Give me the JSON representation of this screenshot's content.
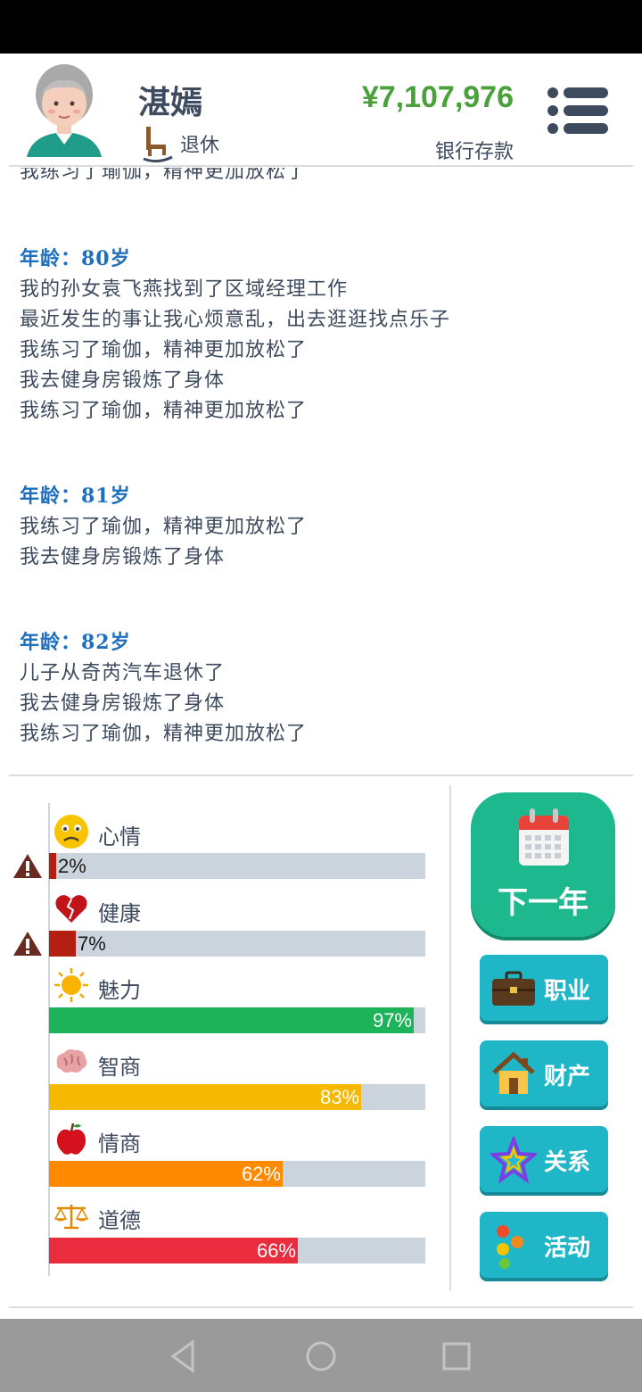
{
  "header": {
    "name": "湛嫣",
    "status": "退休",
    "money": "¥7,107,976",
    "money_label": "银行存款"
  },
  "log": {
    "cut_line": "我练习了瑜伽，精神更加放松了",
    "entries": [
      {
        "age": "年龄：80岁",
        "lines": [
          "我的孙女袁飞燕找到了区域经理工作",
          "最近发生的事让我心烦意乱，出去逛逛找点乐子",
          "我练习了瑜伽，精神更加放松了",
          "我去健身房锻炼了身体",
          "我练习了瑜伽，精神更加放松了"
        ]
      },
      {
        "age": "年龄：81岁",
        "lines": [
          "我练习了瑜伽，精神更加放松了",
          "我去健身房锻炼了身体"
        ]
      },
      {
        "age": "年龄：82岁",
        "lines": [
          "儿子从奇芮汽车退休了",
          "我去健身房锻炼了身体",
          "我练习了瑜伽，精神更加放松了"
        ]
      }
    ]
  },
  "stats": [
    {
      "name": "心情",
      "value": 2,
      "pct": "2%",
      "color": "#b32012",
      "warning": true,
      "icon": "sad-face-icon"
    },
    {
      "name": "健康",
      "value": 7,
      "pct": "7%",
      "color": "#b32012",
      "warning": true,
      "icon": "broken-heart-icon"
    },
    {
      "name": "魅力",
      "value": 97,
      "pct": "97%",
      "color": "#1cb35a",
      "warning": false,
      "icon": "sun-icon"
    },
    {
      "name": "智商",
      "value": 83,
      "pct": "83%",
      "color": "#f6b800",
      "warning": false,
      "icon": "brain-icon"
    },
    {
      "name": "情商",
      "value": 62,
      "pct": "62%",
      "color": "#ff8a00",
      "warning": false,
      "icon": "apple-icon"
    },
    {
      "name": "道德",
      "value": 66,
      "pct": "66%",
      "color": "#ea2d3e",
      "warning": false,
      "icon": "scales-icon"
    }
  ],
  "buttons": {
    "next_year": "下一年",
    "career": "职业",
    "assets": "财产",
    "relations": "关系",
    "activities": "活动"
  }
}
